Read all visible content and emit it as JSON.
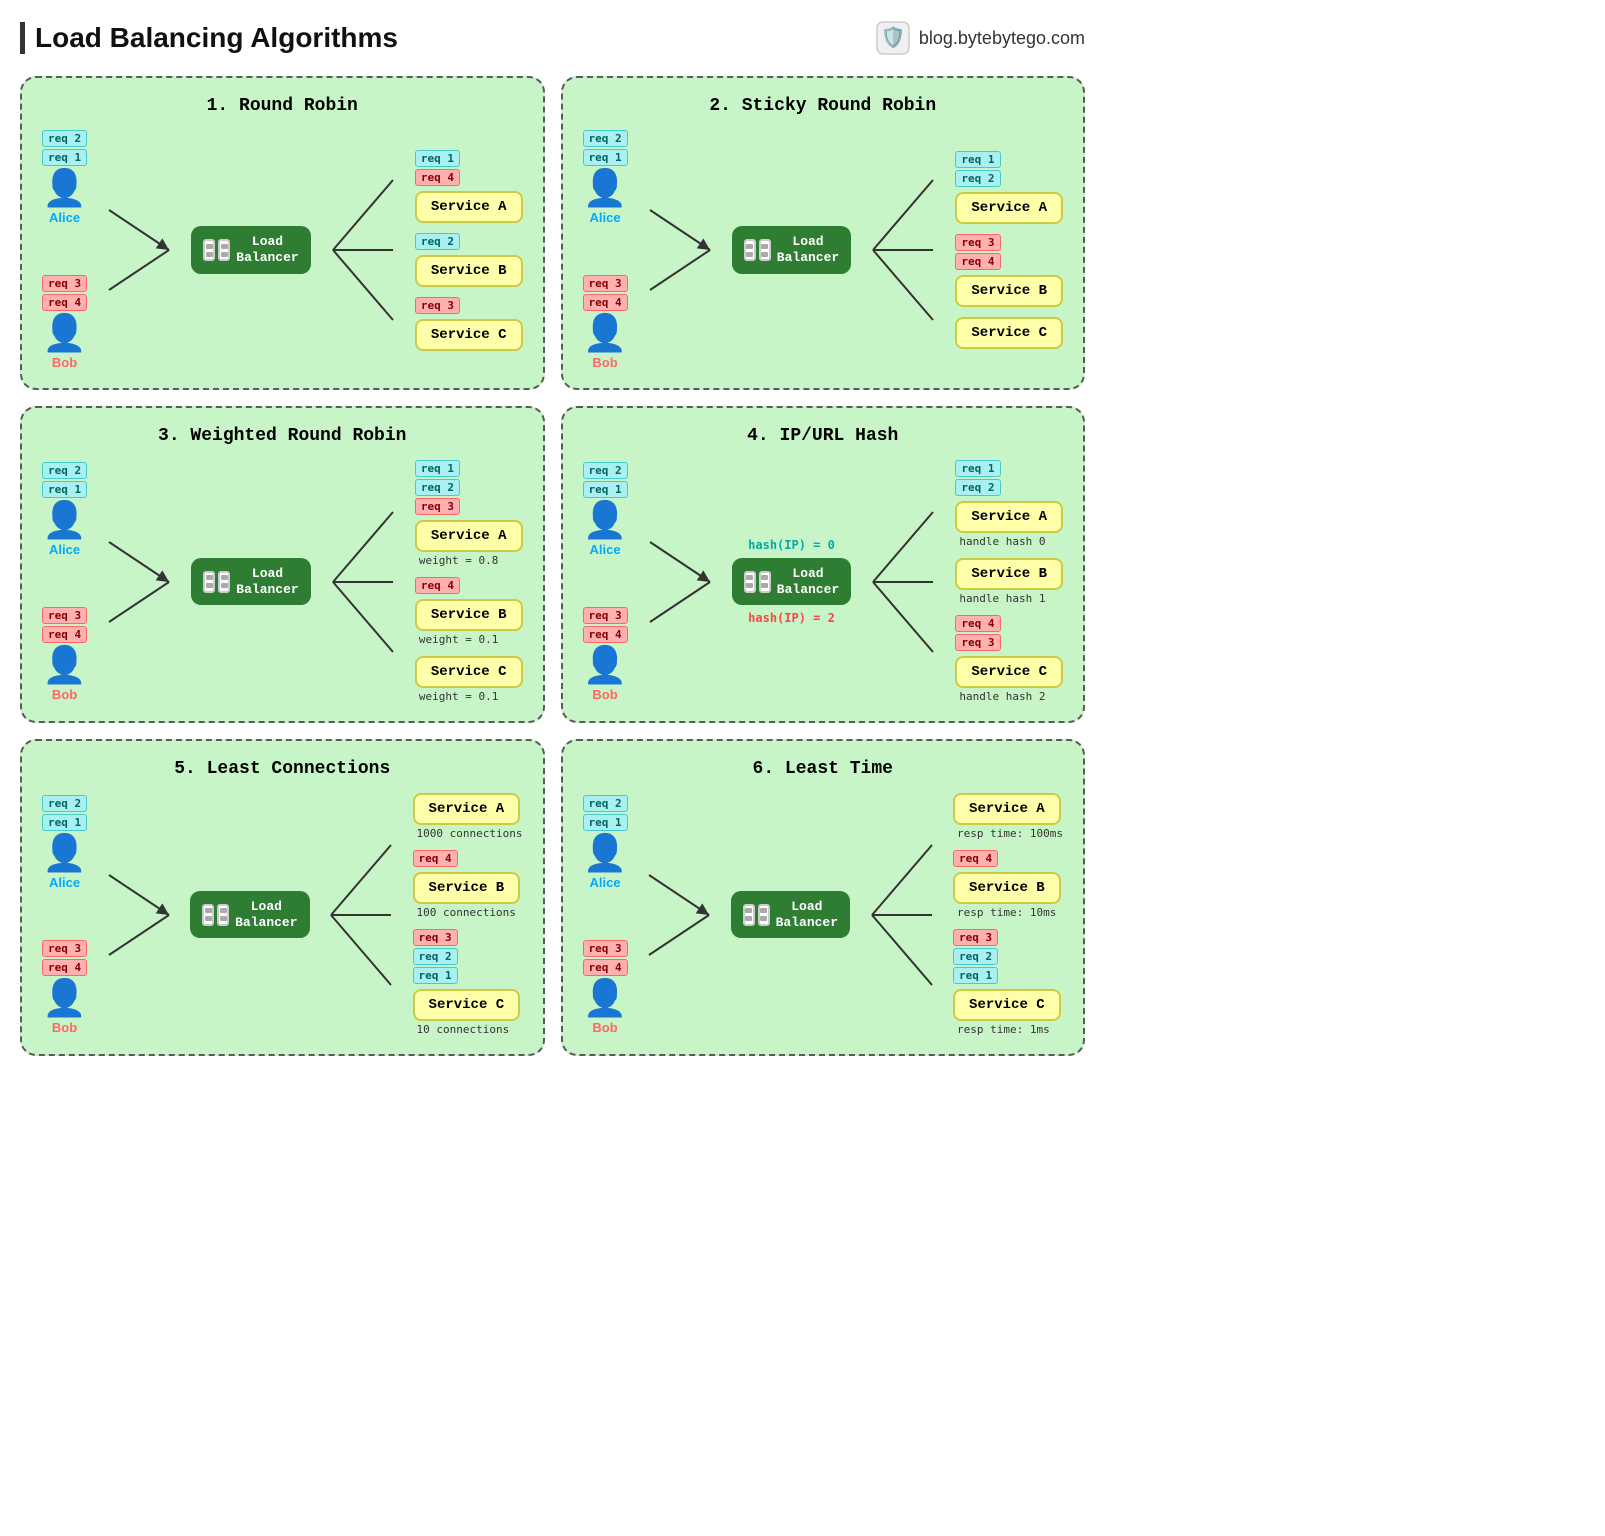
{
  "page": {
    "title": "Load Balancing Algorithms",
    "brand": "blog.bytebytego.com"
  },
  "panels": [
    {
      "id": "round-robin",
      "title": "1.  Round Robin",
      "users": [
        {
          "name": "Alice",
          "color": "alice"
        },
        {
          "name": "Bob",
          "color": "bob"
        }
      ],
      "alice_reqs": [
        "req 2",
        "req 1"
      ],
      "bob_reqs": [
        "req 3",
        "req 4"
      ],
      "right_reqs_A": [
        "req 1",
        "req 4"
      ],
      "right_reqs_B": [
        "req 2"
      ],
      "right_reqs_C": [
        "req 3"
      ],
      "services": [
        {
          "name": "Service A",
          "note": ""
        },
        {
          "name": "Service B",
          "note": ""
        },
        {
          "name": "Service C",
          "note": ""
        }
      ]
    },
    {
      "id": "sticky-round-robin",
      "title": "2.  Sticky Round Robin",
      "alice_reqs": [
        "req 2",
        "req 1"
      ],
      "bob_reqs": [
        "req 3",
        "req 4"
      ],
      "right_reqs_A": [
        "req 1",
        "req 2"
      ],
      "right_reqs_B": [
        "req 3",
        "req 4"
      ],
      "right_reqs_C": [],
      "services": [
        {
          "name": "Service A",
          "note": ""
        },
        {
          "name": "Service B",
          "note": ""
        },
        {
          "name": "Service C",
          "note": ""
        }
      ]
    },
    {
      "id": "weighted-round-robin",
      "title": "3.  Weighted Round Robin",
      "alice_reqs": [
        "req 2",
        "req 1"
      ],
      "bob_reqs": [
        "req 3",
        "req 4"
      ],
      "right_reqs_A": [
        "req 1",
        "req 2",
        "req 3"
      ],
      "right_reqs_B": [
        "req 4"
      ],
      "right_reqs_C": [],
      "services": [
        {
          "name": "Service A",
          "note": "weight = 0.8"
        },
        {
          "name": "Service B",
          "note": "weight = 0.1"
        },
        {
          "name": "Service C",
          "note": "weight = 0.1"
        }
      ]
    },
    {
      "id": "ip-url-hash",
      "title": "4.  IP/URL Hash",
      "alice_reqs": [
        "req 2",
        "req 1"
      ],
      "bob_reqs": [
        "req 3",
        "req 4"
      ],
      "hash_alice": "hash(IP) = 0",
      "hash_bob": "hash(IP) = 2",
      "right_reqs_A": [
        "req 1",
        "req 2"
      ],
      "right_reqs_B": [],
      "right_reqs_C": [
        "req 4",
        "req 3"
      ],
      "services": [
        {
          "name": "Service A",
          "note": "handle hash 0"
        },
        {
          "name": "Service B",
          "note": "handle hash 1"
        },
        {
          "name": "Service C",
          "note": "handle hash 2"
        }
      ]
    },
    {
      "id": "least-connections",
      "title": "5.  Least Connections",
      "alice_reqs": [
        "req 2",
        "req 1"
      ],
      "bob_reqs": [
        "req 3",
        "req 4"
      ],
      "right_reqs_A": [],
      "right_reqs_B": [
        "req 4"
      ],
      "right_reqs_C": [
        "req 3",
        "req 2",
        "req 1"
      ],
      "services": [
        {
          "name": "Service A",
          "note": "1000 connections"
        },
        {
          "name": "Service B",
          "note": "100 connections"
        },
        {
          "name": "Service C",
          "note": "10 connections"
        }
      ]
    },
    {
      "id": "least-time",
      "title": "6.  Least Time",
      "alice_reqs": [
        "req 2",
        "req 1"
      ],
      "bob_reqs": [
        "req 3",
        "req 4"
      ],
      "right_reqs_A": [],
      "right_reqs_B": [
        "req 4"
      ],
      "right_reqs_C": [
        "req 3",
        "req 2",
        "req 1"
      ],
      "services": [
        {
          "name": "Service A",
          "note": "resp time: 100ms"
        },
        {
          "name": "Service B",
          "note": "resp time: 10ms"
        },
        {
          "name": "Service C",
          "note": "resp time: 1ms"
        }
      ]
    }
  ],
  "lb": {
    "label_line1": "Load",
    "label_line2": "Balancer"
  }
}
